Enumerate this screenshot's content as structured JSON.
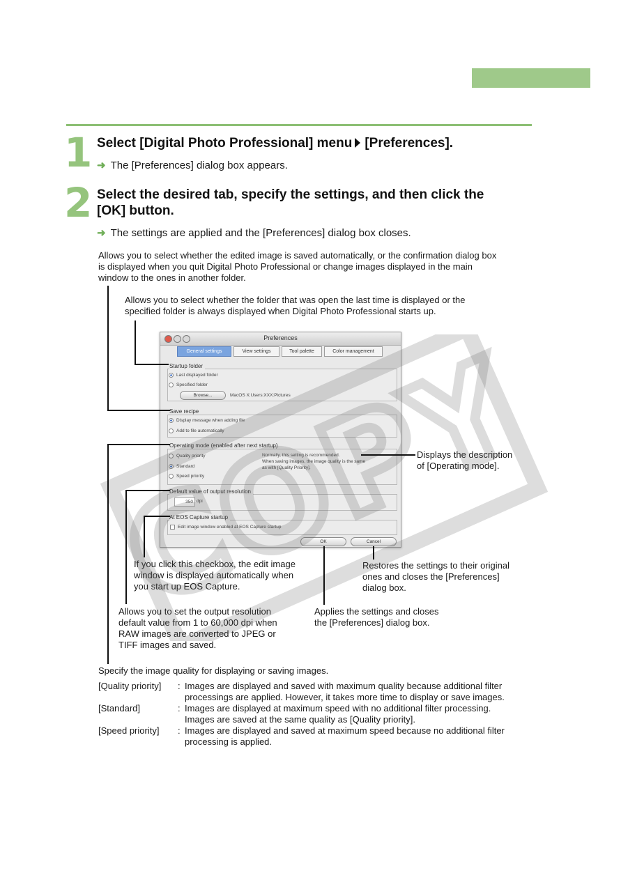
{
  "step1": {
    "number": "1",
    "title_part1": "Select [Digital Photo Professional] menu",
    "title_part2": "[Preferences].",
    "result_arrow": "➜",
    "result": "The [Preferences] dialog box appears."
  },
  "step2": {
    "number": "2",
    "title_line1": "Select the desired tab, specify the settings, and then click the",
    "title_line2": "[OK] button.",
    "result_arrow": "➜",
    "result": "The settings are applied and the [Preferences] dialog box closes."
  },
  "callouts": {
    "save_recipe": [
      "Allows you to select whether the edited image is saved automatically, or the confirmation dialog box",
      "is displayed when you quit Digital Photo Professional or change images displayed in the main",
      "window to the ones in another folder."
    ],
    "startup_folder": [
      "Allows you to select whether the folder that was open the last time is displayed or the",
      "specified folder is always displayed when Digital Photo Professional starts up."
    ],
    "operating_mode_desc": [
      "Displays the description",
      "of [Operating mode]."
    ],
    "eos_checkbox": [
      "If you click this checkbox, the edit image",
      "window is displayed automatically when",
      "you start up EOS Capture."
    ],
    "cancel": [
      "Restores the settings to their original",
      "ones and closes the [Preferences]",
      "dialog box."
    ],
    "resolution": [
      "Allows you to set the output resolution",
      "default value from 1 to 60,000 dpi when",
      "RAW images are converted to JPEG or",
      "TIFF images and saved."
    ],
    "ok": [
      "Applies the settings and closes",
      "the [Preferences] dialog box."
    ],
    "quality_intro": "Specify the image quality for displaying or saving images."
  },
  "quality_items": [
    {
      "label": "[Quality priority]",
      "sep": ":",
      "lines": [
        "Images are displayed and saved with maximum quality because additional filter",
        "processings are applied. However, it takes more time to display or save images."
      ]
    },
    {
      "label": "[Standard]",
      "sep": ":",
      "lines": [
        "Images are displayed at maximum speed with no additional filter processing.",
        "Images are saved at the same quality as [Quality priority]."
      ]
    },
    {
      "label": "[Speed priority]",
      "sep": ":",
      "lines": [
        "Images are displayed and saved at maximum speed because no additional filter",
        "processing is applied."
      ]
    }
  ],
  "dialog": {
    "title": "Preferences",
    "tabs": [
      "General settings",
      "View settings",
      "Tool palette",
      "Color management"
    ],
    "startup": {
      "title": "Startup folder",
      "opt1": "Last displayed folder",
      "opt2": "Specified folder",
      "browse": "Browse...",
      "path": "MacOS X:Users:XXX:Pictures"
    },
    "save": {
      "title": "Save recipe",
      "opt1": "Display message when adding file",
      "opt2": "Add to file automatically"
    },
    "mode": {
      "title": "Operating mode (enabled after next startup)",
      "opt1": "Quality priority",
      "opt2": "Standard",
      "opt3": "Speed priority",
      "desc1": "Normally, this setting is recommended.",
      "desc2": "When saving images, the image quality is the same",
      "desc3": "as with [Quality Priority]."
    },
    "resolution": {
      "title": "Default value of output resolution",
      "value": "350",
      "unit": "dpi"
    },
    "eos": {
      "title": "At EOS Capture startup",
      "opt1": "Edit image window enabled at EOS Capture startup"
    },
    "ok": "OK",
    "cancel": "Cancel"
  },
  "watermark": "COPY",
  "colors": {
    "accent_green": "#8cbf74",
    "tab_blue": "#7aa4df"
  }
}
